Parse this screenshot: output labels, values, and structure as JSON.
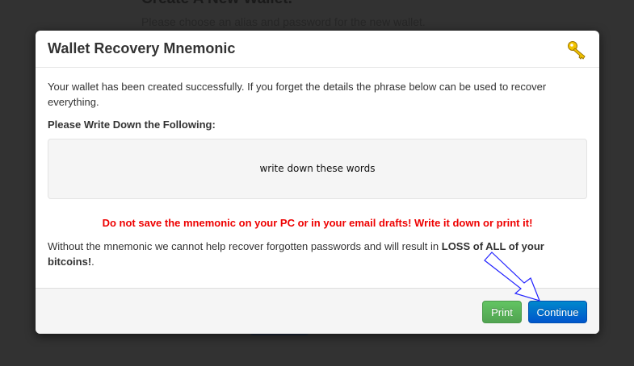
{
  "background": {
    "title": "Create A New Wallet.",
    "subtitle": "Please choose an alias and password for the new wallet."
  },
  "modal": {
    "title": "Wallet Recovery Mnemonic",
    "intro": "Your wallet has been created successfully. If you forget the details the phrase below can be used to recover everything.",
    "instruction": "Please Write Down the Following:",
    "mnemonic": "write down these words",
    "warning": "Do not save the mnemonic on your PC or in your email drafts! Write it down or print it!",
    "loss_text": "Without the mnemonic we cannot help recover forgotten passwords and will result in ",
    "loss_bold": "LOSS of ALL of your bitcoins!",
    "loss_end": ".",
    "print_label": "Print",
    "continue_label": "Continue"
  },
  "colors": {
    "warning": "#ee0000",
    "print": "#5bb75b",
    "continue": "#006dcc",
    "arrow": "#2222ff"
  }
}
